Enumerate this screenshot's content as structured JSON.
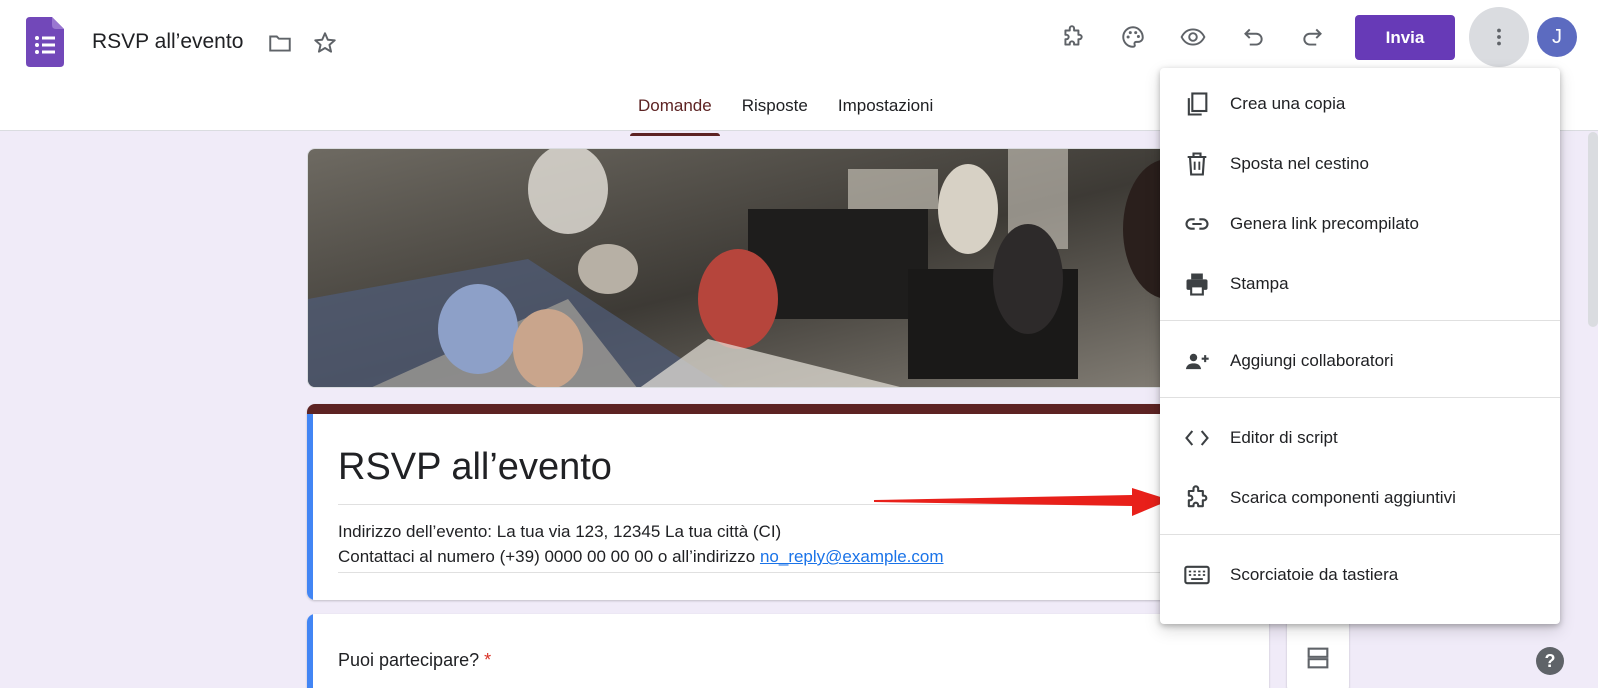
{
  "header": {
    "doc_title": "RSVP all’evento",
    "send_label": "Invia",
    "avatar_initial": "J",
    "icons": [
      "folder-icon",
      "star-icon",
      "addons-icon",
      "palette-icon",
      "preview-icon",
      "undo-icon",
      "redo-icon",
      "more-vert-icon"
    ]
  },
  "tabs": [
    {
      "label": "Domande",
      "active": true
    },
    {
      "label": "Risposte",
      "active": false
    },
    {
      "label": "Impostazioni",
      "active": false
    }
  ],
  "form": {
    "title": "RSVP all’evento",
    "description_line1": "Indirizzo dell’evento: La tua via 123, 12345 La tua città (CI)",
    "description_line2_prefix": "Contattaci al numero (+39) 0000 00 00 00 o all’indirizzo ",
    "description_email": "no_reply@example.com",
    "question1": "Puoi partecipare?",
    "required_mark": "*"
  },
  "menu": {
    "items": [
      {
        "label": "Crea una copia",
        "icon": "copy-icon"
      },
      {
        "label": "Sposta nel cestino",
        "icon": "trash-icon"
      },
      {
        "label": "Genera link precompilato",
        "icon": "link-icon"
      },
      {
        "label": "Stampa",
        "icon": "print-icon"
      },
      {
        "label": "Aggiungi collaboratori",
        "icon": "add-people-icon"
      },
      {
        "label": "Editor di script",
        "icon": "code-icon"
      },
      {
        "label": "Scarica componenti aggiuntivi",
        "icon": "puzzle-icon"
      },
      {
        "label": "Scorciatoie da tastiera",
        "icon": "keyboard-icon"
      }
    ]
  },
  "colors": {
    "accent": "#673ab7",
    "theme": "#5d2323",
    "section_bar": "#4285f4",
    "arrow": "#e8201a"
  }
}
